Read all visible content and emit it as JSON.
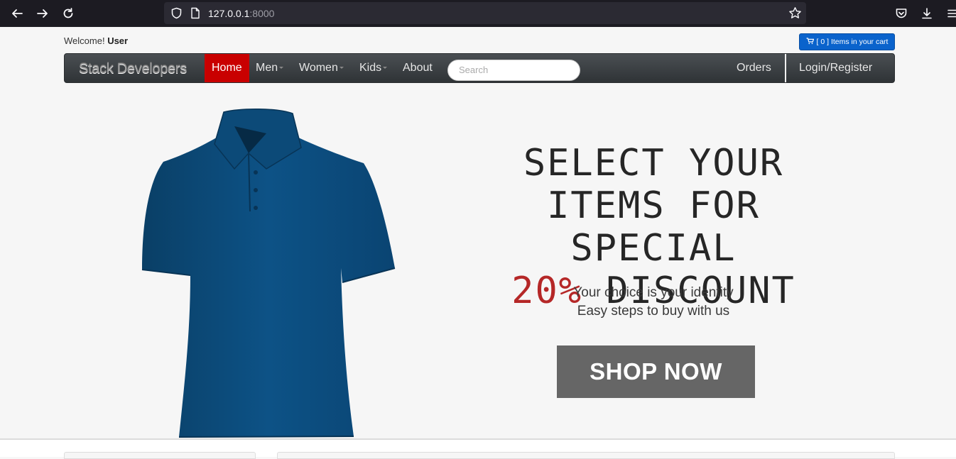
{
  "browser": {
    "url_host": "127.0.0.1",
    "url_port": ":8000"
  },
  "header": {
    "welcome_prefix": "Welcome!",
    "welcome_user": "User",
    "cart_label": "[ 0 ] Items in your cart"
  },
  "nav": {
    "brand": "Stack Developers",
    "items": [
      {
        "label": "Home",
        "active": true
      },
      {
        "label": "Men",
        "dropdown": true
      },
      {
        "label": "Women",
        "dropdown": true
      },
      {
        "label": "Kids",
        "dropdown": true
      },
      {
        "label": "About"
      }
    ],
    "search_placeholder": "Search",
    "orders": "Orders",
    "login": "Login/Register"
  },
  "hero": {
    "line1": "SELECT YOUR",
    "line2": "ITEMS FOR SPECIAL",
    "discount": "20%",
    "discount_word": "DISCOUNT",
    "sub1": "Your choice is your identity",
    "sub2": "Easy steps to buy with us",
    "button": "SHOP NOW",
    "image_icon": "polo-shirt-image"
  },
  "colors": {
    "accent_red": "#c90000",
    "cart_blue": "#0a63cc",
    "shirt_blue": "#0b4f7e"
  }
}
